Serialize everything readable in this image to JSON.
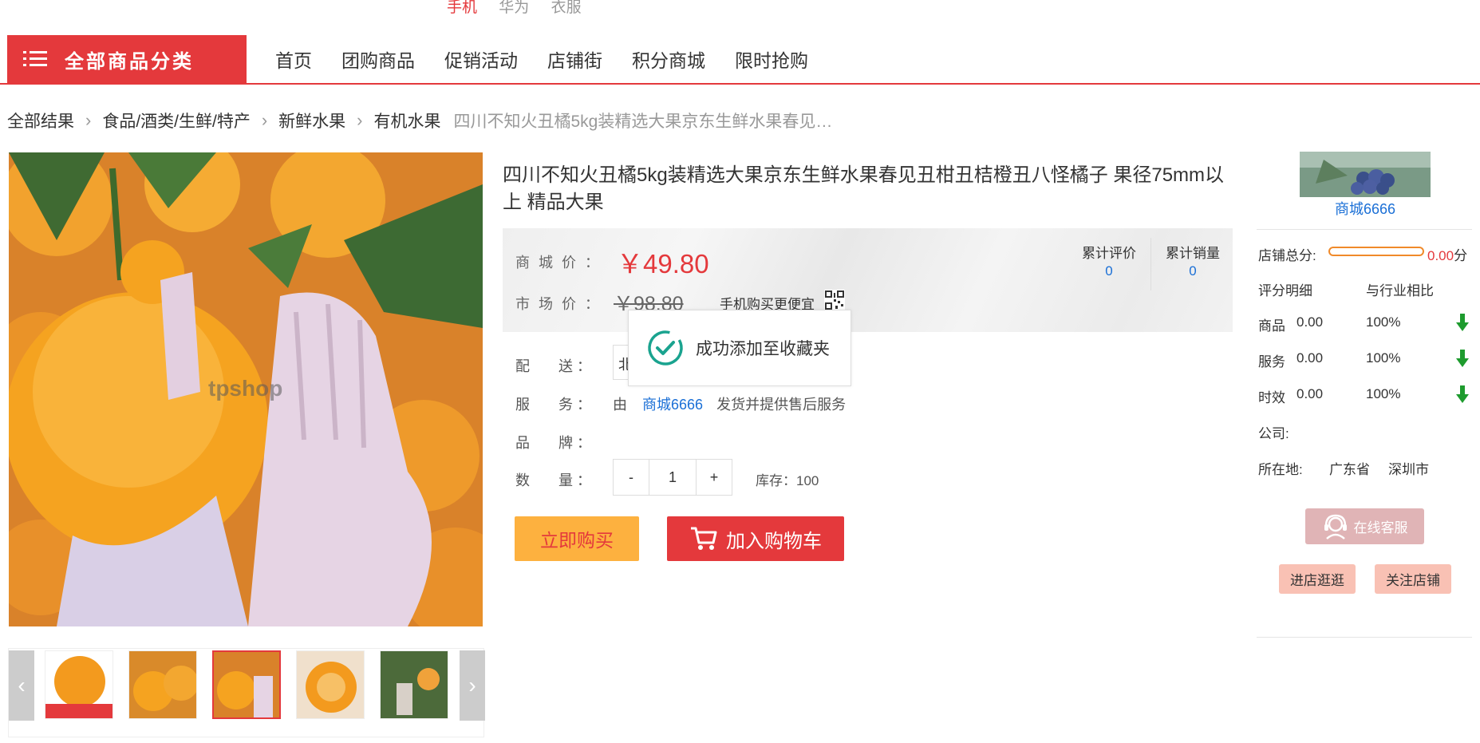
{
  "hot_words": [
    "手机",
    "华为",
    "衣服"
  ],
  "nav": {
    "category_label": "全部商品分类",
    "links": [
      "首页",
      "团购商品",
      "促销活动",
      "店铺街",
      "积分商城",
      "限时抢购"
    ]
  },
  "breadcrumb": {
    "items": [
      "全部结果",
      "食品/酒类/生鲜/特产",
      "新鲜水果",
      "有机水果"
    ],
    "current": "四川不知火丑橘5kg装精选大果京东生鲜水果春见…"
  },
  "product": {
    "title": "四川不知火丑橘5kg装精选大果京东生鲜水果春见丑柑丑桔橙丑八怪橘子 果径75mm以上 精品大果",
    "watermark": "tpshop",
    "mall_price_label": "商 城 价 ：",
    "mall_price": "￥49.80",
    "market_price_label": "市 场 价 ：",
    "market_price": "￥98.80",
    "mobile_label": "手机购买更便宜",
    "review_label": "累计评价",
    "review_count": "0",
    "sales_label": "累计销量",
    "sales_count": "0",
    "delivery_label": "配　　送 ：",
    "delivery_value": "北",
    "service_label": "服　　务 ：",
    "service_prefix": "由",
    "service_shop": "商城6666",
    "service_suffix": "发货并提供售后服务",
    "brand_label": "品　　牌 ：",
    "qty_label": "数　　量 ：",
    "qty_minus": "-",
    "qty_value": "1",
    "qty_plus": "+",
    "stock": "库存：100",
    "buy_now": "立即购买",
    "add_cart": "加入购物车"
  },
  "toast": {
    "message": "成功添加至收藏夹"
  },
  "shop": {
    "name": "商城6666",
    "total_score_label": "店铺总分:",
    "total_score": "0.00",
    "score_unit": "分",
    "detail_label": "评分明细",
    "compare_label": "与行业相比",
    "rows": [
      {
        "name": "商品",
        "score": "0.00",
        "pct": "100%"
      },
      {
        "name": "服务",
        "score": "0.00",
        "pct": "100%"
      },
      {
        "name": "时效",
        "score": "0.00",
        "pct": "100%"
      }
    ],
    "company_label": "公司:",
    "location_label": "所在地:",
    "province": "广东省",
    "city": "深圳市",
    "service_btn": "在线客服",
    "enter_btn": "进店逛逛",
    "follow_btn": "关注店铺"
  },
  "colors": {
    "accent": "#e4393c",
    "link": "#1a6fd6",
    "buy": "#fdb13f"
  }
}
